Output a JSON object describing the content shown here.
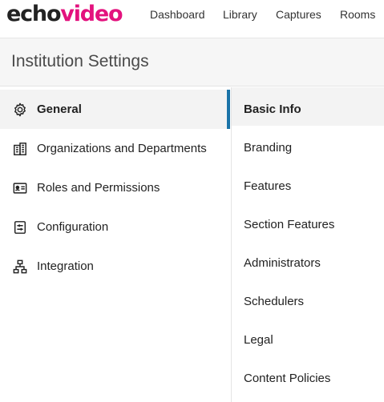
{
  "brand": {
    "logo_echo": "echo",
    "logo_video": "video",
    "accent_color": "#e3127e",
    "active_indicator_color": "#1a73a8"
  },
  "nav": {
    "items": [
      {
        "label": "Dashboard"
      },
      {
        "label": "Library"
      },
      {
        "label": "Captures"
      },
      {
        "label": "Rooms"
      }
    ]
  },
  "page": {
    "title": "Institution Settings"
  },
  "sidebar": {
    "items": [
      {
        "label": "General",
        "icon": "gear-icon",
        "active": true
      },
      {
        "label": "Organizations and Departments",
        "icon": "building-icon",
        "active": false
      },
      {
        "label": "Roles and Permissions",
        "icon": "id-card-icon",
        "active": false
      },
      {
        "label": "Configuration",
        "icon": "sliders-icon",
        "active": false
      },
      {
        "label": "Integration",
        "icon": "network-icon",
        "active": false
      }
    ]
  },
  "subnav": {
    "items": [
      {
        "label": "Basic Info",
        "active": true
      },
      {
        "label": "Branding",
        "active": false
      },
      {
        "label": "Features",
        "active": false
      },
      {
        "label": "Section Features",
        "active": false
      },
      {
        "label": "Administrators",
        "active": false
      },
      {
        "label": "Schedulers",
        "active": false
      },
      {
        "label": "Legal",
        "active": false
      },
      {
        "label": "Content Policies",
        "active": false
      }
    ]
  }
}
